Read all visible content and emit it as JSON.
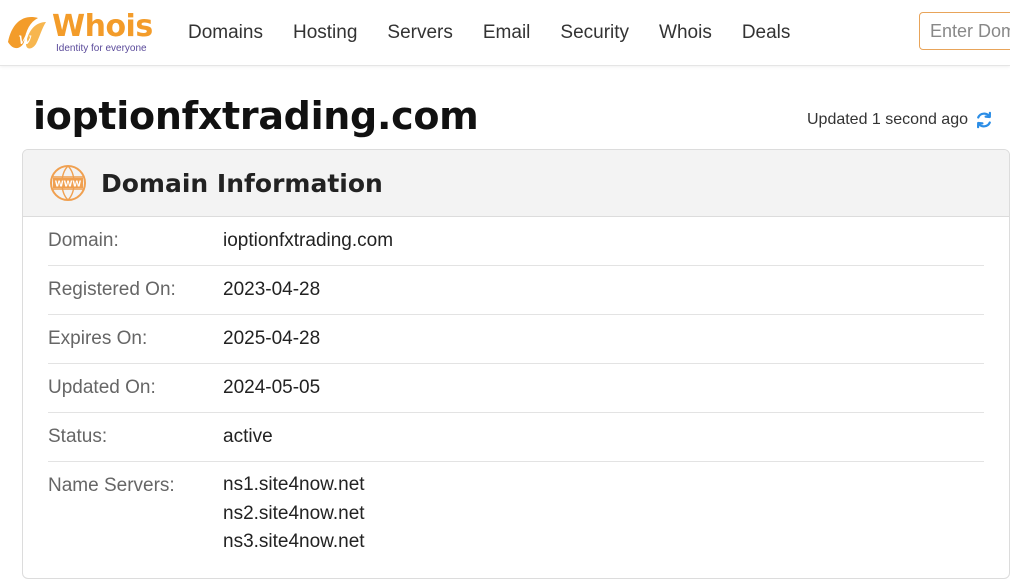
{
  "brand": {
    "name": "Whois",
    "tagline": "Identity for everyone",
    "accent": "#f39c2a"
  },
  "nav": {
    "items": [
      "Domains",
      "Hosting",
      "Servers",
      "Email",
      "Security",
      "Whois",
      "Deals"
    ]
  },
  "search": {
    "placeholder": "Enter Domain"
  },
  "page": {
    "title": "ioptionfxtrading.com",
    "updated": "Updated 1 second ago"
  },
  "domain_info": {
    "heading": "Domain Information",
    "rows": [
      {
        "label": "Domain:",
        "value": "ioptionfxtrading.com"
      },
      {
        "label": "Registered On:",
        "value": "2023-04-28"
      },
      {
        "label": "Expires On:",
        "value": "2025-04-28"
      },
      {
        "label": "Updated On:",
        "value": "2024-05-05"
      },
      {
        "label": "Status:",
        "value": "active"
      }
    ],
    "name_servers_label": "Name Servers:",
    "name_servers": [
      "ns1.site4now.net",
      "ns2.site4now.net",
      "ns3.site4now.net"
    ]
  },
  "icons": {
    "logo": "whois-logo-icon",
    "refresh": "refresh-icon",
    "www": "www-globe-icon"
  }
}
